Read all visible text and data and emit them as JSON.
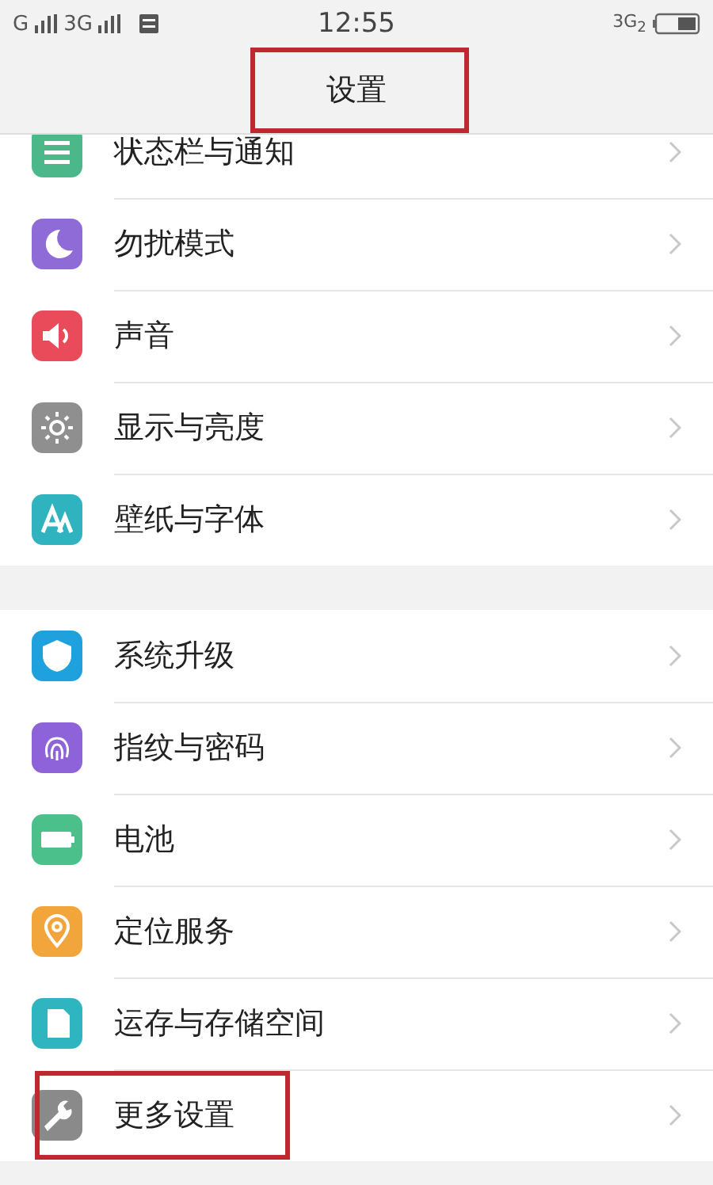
{
  "status_bar": {
    "carrier_1": "G",
    "carrier_2": "3G",
    "time": "12:55",
    "network": "3G$_{2}$"
  },
  "header": {
    "title": "设置",
    "highlighted": true
  },
  "groups": [
    {
      "items": [
        {
          "label": "状态栏与通知",
          "kind": "list",
          "color": "#4cb88a",
          "highlighted": false
        },
        {
          "label": "勿扰模式",
          "kind": "moon",
          "color": "#8e6bd6",
          "highlighted": false
        },
        {
          "label": "声音",
          "kind": "speaker",
          "color": "#e94b5a",
          "highlighted": false
        },
        {
          "label": "显示与亮度",
          "kind": "sun",
          "color": "#8f8f8f",
          "highlighted": false
        },
        {
          "label": "壁纸与字体",
          "kind": "letters",
          "color": "#2fb3bf",
          "highlighted": false
        }
      ]
    },
    {
      "items": [
        {
          "label": "系统升级",
          "kind": "shield",
          "color": "#1ea1dc",
          "highlighted": false
        },
        {
          "label": "指纹与密码",
          "kind": "fingerprint",
          "color": "#8e62d9",
          "highlighted": false
        },
        {
          "label": "电池",
          "kind": "battery",
          "color": "#4cc08a",
          "highlighted": false
        },
        {
          "label": "定位服务",
          "kind": "pin",
          "color": "#f2a53a",
          "highlighted": false
        },
        {
          "label": "运存与存储空间",
          "kind": "card",
          "color": "#2fb5c0",
          "highlighted": false
        },
        {
          "label": "更多设置",
          "kind": "wrench",
          "color": "#8a8a8a",
          "highlighted": true
        }
      ]
    }
  ]
}
